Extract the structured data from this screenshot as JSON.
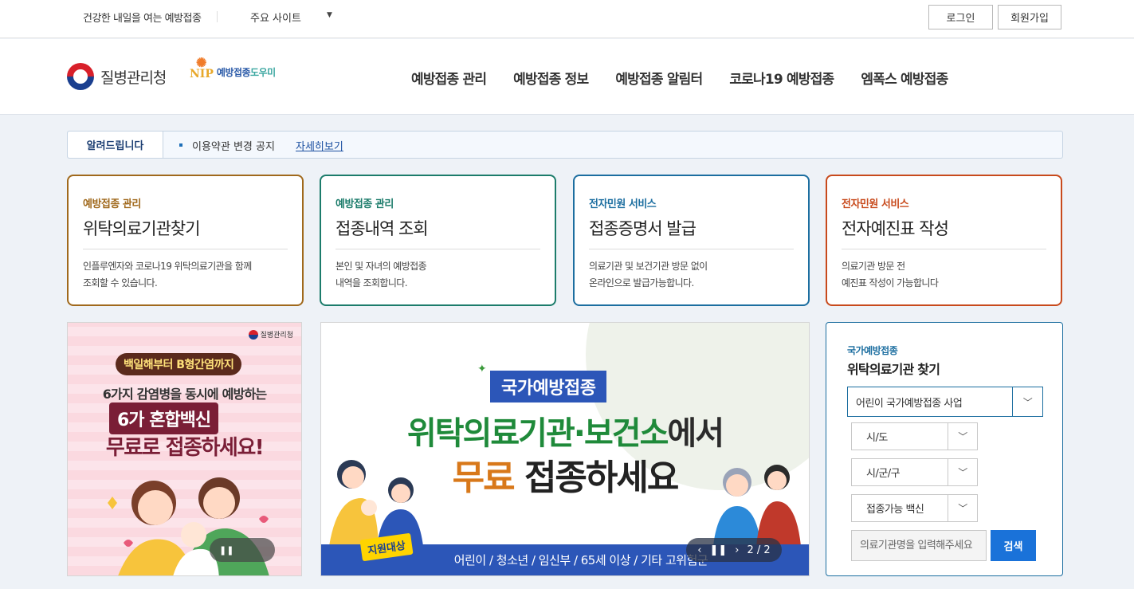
{
  "topbar": {
    "slogan": "건강한 내일을 여는 예방접종",
    "sites_label": "주요 사이트",
    "login": "로그인",
    "join": "회원가입"
  },
  "header": {
    "kdca_name": "질병관리청",
    "nip_mark": "NIP",
    "nip_text_a": "예방접종",
    "nip_text_b": "도우미",
    "nav": [
      "예방접종 관리",
      "예방접종 정보",
      "예방접종 알림터",
      "코로나19 예방접종",
      "엠폭스 예방접종"
    ]
  },
  "notice": {
    "title": "알려드립니다",
    "text": "이용약관 변경 공지",
    "link": "자세히보기"
  },
  "cards": [
    {
      "category": "예방접종 관리",
      "title": "위탁의료기관찾기",
      "desc": "인플루엔자와 코로나19 위탁의료기관을 함께\n조회할 수 있습니다."
    },
    {
      "category": "예방접종 관리",
      "title": "접종내역 조회",
      "desc": "본인 및 자녀의 예방접종\n내역을 조회합니다."
    },
    {
      "category": "전자민원 서비스",
      "title": "접종증명서 발급",
      "desc": "의료기관 및 보건기관 방문 없이\n온라인으로 발급가능합니다."
    },
    {
      "category": "전자민원 서비스",
      "title": "전자예진표 작성",
      "desc": "의료기관 방문 전\n예진표 작성이 가능합니다"
    }
  ],
  "banner_left": {
    "logo": "질병관리청",
    "pill": "백일해부터 B형간염까지",
    "line2": "6가지 감염병을 동시에 예방하는",
    "line3": "6가 혼합백신",
    "line4": "무료로 접종하세요!"
  },
  "banner_center": {
    "tag": "국가예방접종",
    "line1_a": "위탁의료기관·보건소",
    "line1_b": "에서",
    "line2_a": "무료",
    "line2_b": " 접종하세요",
    "support": "지원대상",
    "bottom": "어린이 / 청소년 / 임신부 / 65세 이상 / 기타 고위험군",
    "counter": "2 / 2"
  },
  "search": {
    "sub": "국가예방접종",
    "title": "위탁의료기관 찾기",
    "program": "어린이 국가예방접종 사업",
    "sido": "시/도",
    "sigungu": "시/군/구",
    "vaccine": "접종가능 백신",
    "placeholder": "의료기관명을 입력해주세요",
    "button": "검색"
  },
  "colors": {
    "card1": "#a0691c",
    "card2": "#1c7c6b",
    "card3": "#1c6ea0",
    "card4": "#c84a1c",
    "search_button": "#1a72d9"
  }
}
